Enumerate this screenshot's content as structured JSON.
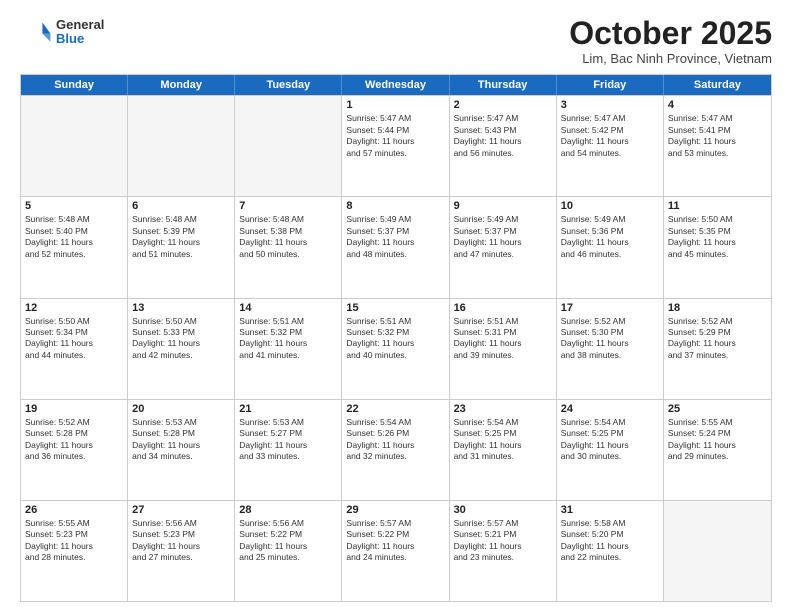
{
  "logo": {
    "general": "General",
    "blue": "Blue"
  },
  "title": "October 2025",
  "subtitle": "Lim, Bac Ninh Province, Vietnam",
  "days": [
    "Sunday",
    "Monday",
    "Tuesday",
    "Wednesday",
    "Thursday",
    "Friday",
    "Saturday"
  ],
  "weeks": [
    [
      {
        "day": "",
        "info": ""
      },
      {
        "day": "",
        "info": ""
      },
      {
        "day": "",
        "info": ""
      },
      {
        "day": "1",
        "info": "Sunrise: 5:47 AM\nSunset: 5:44 PM\nDaylight: 11 hours\nand 57 minutes."
      },
      {
        "day": "2",
        "info": "Sunrise: 5:47 AM\nSunset: 5:43 PM\nDaylight: 11 hours\nand 56 minutes."
      },
      {
        "day": "3",
        "info": "Sunrise: 5:47 AM\nSunset: 5:42 PM\nDaylight: 11 hours\nand 54 minutes."
      },
      {
        "day": "4",
        "info": "Sunrise: 5:47 AM\nSunset: 5:41 PM\nDaylight: 11 hours\nand 53 minutes."
      }
    ],
    [
      {
        "day": "5",
        "info": "Sunrise: 5:48 AM\nSunset: 5:40 PM\nDaylight: 11 hours\nand 52 minutes."
      },
      {
        "day": "6",
        "info": "Sunrise: 5:48 AM\nSunset: 5:39 PM\nDaylight: 11 hours\nand 51 minutes."
      },
      {
        "day": "7",
        "info": "Sunrise: 5:48 AM\nSunset: 5:38 PM\nDaylight: 11 hours\nand 50 minutes."
      },
      {
        "day": "8",
        "info": "Sunrise: 5:49 AM\nSunset: 5:37 PM\nDaylight: 11 hours\nand 48 minutes."
      },
      {
        "day": "9",
        "info": "Sunrise: 5:49 AM\nSunset: 5:37 PM\nDaylight: 11 hours\nand 47 minutes."
      },
      {
        "day": "10",
        "info": "Sunrise: 5:49 AM\nSunset: 5:36 PM\nDaylight: 11 hours\nand 46 minutes."
      },
      {
        "day": "11",
        "info": "Sunrise: 5:50 AM\nSunset: 5:35 PM\nDaylight: 11 hours\nand 45 minutes."
      }
    ],
    [
      {
        "day": "12",
        "info": "Sunrise: 5:50 AM\nSunset: 5:34 PM\nDaylight: 11 hours\nand 44 minutes."
      },
      {
        "day": "13",
        "info": "Sunrise: 5:50 AM\nSunset: 5:33 PM\nDaylight: 11 hours\nand 42 minutes."
      },
      {
        "day": "14",
        "info": "Sunrise: 5:51 AM\nSunset: 5:32 PM\nDaylight: 11 hours\nand 41 minutes."
      },
      {
        "day": "15",
        "info": "Sunrise: 5:51 AM\nSunset: 5:32 PM\nDaylight: 11 hours\nand 40 minutes."
      },
      {
        "day": "16",
        "info": "Sunrise: 5:51 AM\nSunset: 5:31 PM\nDaylight: 11 hours\nand 39 minutes."
      },
      {
        "day": "17",
        "info": "Sunrise: 5:52 AM\nSunset: 5:30 PM\nDaylight: 11 hours\nand 38 minutes."
      },
      {
        "day": "18",
        "info": "Sunrise: 5:52 AM\nSunset: 5:29 PM\nDaylight: 11 hours\nand 37 minutes."
      }
    ],
    [
      {
        "day": "19",
        "info": "Sunrise: 5:52 AM\nSunset: 5:28 PM\nDaylight: 11 hours\nand 36 minutes."
      },
      {
        "day": "20",
        "info": "Sunrise: 5:53 AM\nSunset: 5:28 PM\nDaylight: 11 hours\nand 34 minutes."
      },
      {
        "day": "21",
        "info": "Sunrise: 5:53 AM\nSunset: 5:27 PM\nDaylight: 11 hours\nand 33 minutes."
      },
      {
        "day": "22",
        "info": "Sunrise: 5:54 AM\nSunset: 5:26 PM\nDaylight: 11 hours\nand 32 minutes."
      },
      {
        "day": "23",
        "info": "Sunrise: 5:54 AM\nSunset: 5:25 PM\nDaylight: 11 hours\nand 31 minutes."
      },
      {
        "day": "24",
        "info": "Sunrise: 5:54 AM\nSunset: 5:25 PM\nDaylight: 11 hours\nand 30 minutes."
      },
      {
        "day": "25",
        "info": "Sunrise: 5:55 AM\nSunset: 5:24 PM\nDaylight: 11 hours\nand 29 minutes."
      }
    ],
    [
      {
        "day": "26",
        "info": "Sunrise: 5:55 AM\nSunset: 5:23 PM\nDaylight: 11 hours\nand 28 minutes."
      },
      {
        "day": "27",
        "info": "Sunrise: 5:56 AM\nSunset: 5:23 PM\nDaylight: 11 hours\nand 27 minutes."
      },
      {
        "day": "28",
        "info": "Sunrise: 5:56 AM\nSunset: 5:22 PM\nDaylight: 11 hours\nand 25 minutes."
      },
      {
        "day": "29",
        "info": "Sunrise: 5:57 AM\nSunset: 5:22 PM\nDaylight: 11 hours\nand 24 minutes."
      },
      {
        "day": "30",
        "info": "Sunrise: 5:57 AM\nSunset: 5:21 PM\nDaylight: 11 hours\nand 23 minutes."
      },
      {
        "day": "31",
        "info": "Sunrise: 5:58 AM\nSunset: 5:20 PM\nDaylight: 11 hours\nand 22 minutes."
      },
      {
        "day": "",
        "info": ""
      }
    ]
  ]
}
